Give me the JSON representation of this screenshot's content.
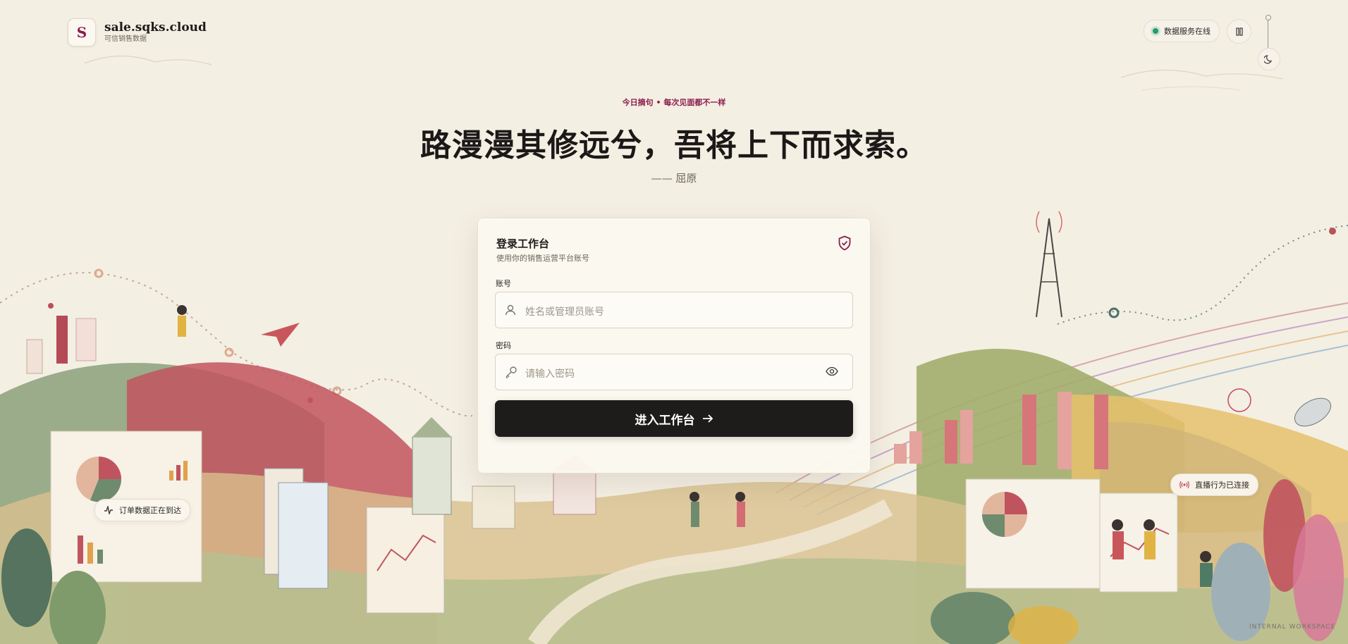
{
  "brand": {
    "logo_letter": "S",
    "name": "sale.sqks.cloud",
    "subtitle": "可信销售数据"
  },
  "status": {
    "label": "数据服务在线",
    "color": "#1f9d6b"
  },
  "controls": {
    "pause_icon": "pause-icon",
    "theme_icon": "moon-icon"
  },
  "quote": {
    "eyebrow": "今日摘句 • 每次见面都不一样",
    "text": "路漫漫其修远兮，吾将上下而求索。",
    "author": "—— 屈原"
  },
  "login": {
    "title": "登录工作台",
    "subtitle": "使用你的销售运营平台账号",
    "account_label": "账号",
    "account_placeholder": "姓名或管理员账号",
    "password_label": "密码",
    "password_placeholder": "请输入密码",
    "submit_label": "进入工作台"
  },
  "chips": {
    "orders": "订单数据正在到达",
    "live": "直播行为已连接"
  },
  "watermark": "INTERNAL WORKSPACE",
  "colors": {
    "accent": "#8c1d4d",
    "button": "#1e1c1b",
    "background": "#f4efe3"
  }
}
